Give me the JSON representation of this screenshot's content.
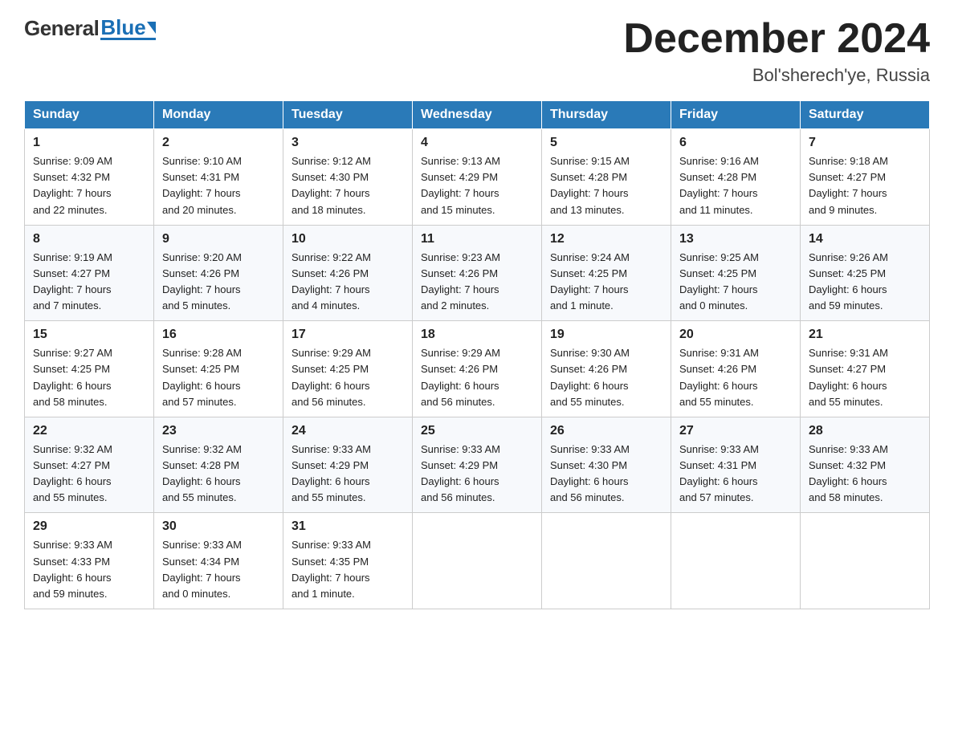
{
  "header": {
    "logo_general": "General",
    "logo_blue": "Blue",
    "month_title": "December 2024",
    "location": "Bol'sherech'ye, Russia"
  },
  "weekdays": [
    "Sunday",
    "Monday",
    "Tuesday",
    "Wednesday",
    "Thursday",
    "Friday",
    "Saturday"
  ],
  "weeks": [
    [
      {
        "day": "1",
        "info": "Sunrise: 9:09 AM\nSunset: 4:32 PM\nDaylight: 7 hours\nand 22 minutes."
      },
      {
        "day": "2",
        "info": "Sunrise: 9:10 AM\nSunset: 4:31 PM\nDaylight: 7 hours\nand 20 minutes."
      },
      {
        "day": "3",
        "info": "Sunrise: 9:12 AM\nSunset: 4:30 PM\nDaylight: 7 hours\nand 18 minutes."
      },
      {
        "day": "4",
        "info": "Sunrise: 9:13 AM\nSunset: 4:29 PM\nDaylight: 7 hours\nand 15 minutes."
      },
      {
        "day": "5",
        "info": "Sunrise: 9:15 AM\nSunset: 4:28 PM\nDaylight: 7 hours\nand 13 minutes."
      },
      {
        "day": "6",
        "info": "Sunrise: 9:16 AM\nSunset: 4:28 PM\nDaylight: 7 hours\nand 11 minutes."
      },
      {
        "day": "7",
        "info": "Sunrise: 9:18 AM\nSunset: 4:27 PM\nDaylight: 7 hours\nand 9 minutes."
      }
    ],
    [
      {
        "day": "8",
        "info": "Sunrise: 9:19 AM\nSunset: 4:27 PM\nDaylight: 7 hours\nand 7 minutes."
      },
      {
        "day": "9",
        "info": "Sunrise: 9:20 AM\nSunset: 4:26 PM\nDaylight: 7 hours\nand 5 minutes."
      },
      {
        "day": "10",
        "info": "Sunrise: 9:22 AM\nSunset: 4:26 PM\nDaylight: 7 hours\nand 4 minutes."
      },
      {
        "day": "11",
        "info": "Sunrise: 9:23 AM\nSunset: 4:26 PM\nDaylight: 7 hours\nand 2 minutes."
      },
      {
        "day": "12",
        "info": "Sunrise: 9:24 AM\nSunset: 4:25 PM\nDaylight: 7 hours\nand 1 minute."
      },
      {
        "day": "13",
        "info": "Sunrise: 9:25 AM\nSunset: 4:25 PM\nDaylight: 7 hours\nand 0 minutes."
      },
      {
        "day": "14",
        "info": "Sunrise: 9:26 AM\nSunset: 4:25 PM\nDaylight: 6 hours\nand 59 minutes."
      }
    ],
    [
      {
        "day": "15",
        "info": "Sunrise: 9:27 AM\nSunset: 4:25 PM\nDaylight: 6 hours\nand 58 minutes."
      },
      {
        "day": "16",
        "info": "Sunrise: 9:28 AM\nSunset: 4:25 PM\nDaylight: 6 hours\nand 57 minutes."
      },
      {
        "day": "17",
        "info": "Sunrise: 9:29 AM\nSunset: 4:25 PM\nDaylight: 6 hours\nand 56 minutes."
      },
      {
        "day": "18",
        "info": "Sunrise: 9:29 AM\nSunset: 4:26 PM\nDaylight: 6 hours\nand 56 minutes."
      },
      {
        "day": "19",
        "info": "Sunrise: 9:30 AM\nSunset: 4:26 PM\nDaylight: 6 hours\nand 55 minutes."
      },
      {
        "day": "20",
        "info": "Sunrise: 9:31 AM\nSunset: 4:26 PM\nDaylight: 6 hours\nand 55 minutes."
      },
      {
        "day": "21",
        "info": "Sunrise: 9:31 AM\nSunset: 4:27 PM\nDaylight: 6 hours\nand 55 minutes."
      }
    ],
    [
      {
        "day": "22",
        "info": "Sunrise: 9:32 AM\nSunset: 4:27 PM\nDaylight: 6 hours\nand 55 minutes."
      },
      {
        "day": "23",
        "info": "Sunrise: 9:32 AM\nSunset: 4:28 PM\nDaylight: 6 hours\nand 55 minutes."
      },
      {
        "day": "24",
        "info": "Sunrise: 9:33 AM\nSunset: 4:29 PM\nDaylight: 6 hours\nand 55 minutes."
      },
      {
        "day": "25",
        "info": "Sunrise: 9:33 AM\nSunset: 4:29 PM\nDaylight: 6 hours\nand 56 minutes."
      },
      {
        "day": "26",
        "info": "Sunrise: 9:33 AM\nSunset: 4:30 PM\nDaylight: 6 hours\nand 56 minutes."
      },
      {
        "day": "27",
        "info": "Sunrise: 9:33 AM\nSunset: 4:31 PM\nDaylight: 6 hours\nand 57 minutes."
      },
      {
        "day": "28",
        "info": "Sunrise: 9:33 AM\nSunset: 4:32 PM\nDaylight: 6 hours\nand 58 minutes."
      }
    ],
    [
      {
        "day": "29",
        "info": "Sunrise: 9:33 AM\nSunset: 4:33 PM\nDaylight: 6 hours\nand 59 minutes."
      },
      {
        "day": "30",
        "info": "Sunrise: 9:33 AM\nSunset: 4:34 PM\nDaylight: 7 hours\nand 0 minutes."
      },
      {
        "day": "31",
        "info": "Sunrise: 9:33 AM\nSunset: 4:35 PM\nDaylight: 7 hours\nand 1 minute."
      },
      {
        "day": "",
        "info": ""
      },
      {
        "day": "",
        "info": ""
      },
      {
        "day": "",
        "info": ""
      },
      {
        "day": "",
        "info": ""
      }
    ]
  ]
}
